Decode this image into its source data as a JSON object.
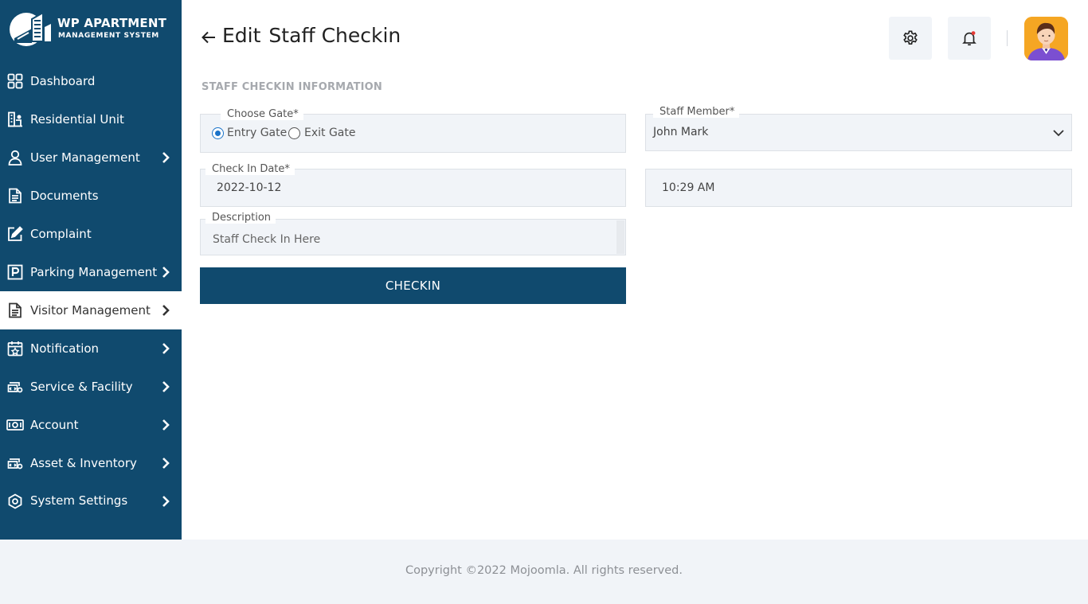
{
  "brand": {
    "line1": "WP APARTMENT",
    "line2": "MANAGEMENT SYSTEM"
  },
  "sidebar": {
    "items": [
      {
        "label": "Dashboard",
        "icon": "dashboard-grid-icon",
        "has_submenu": false,
        "active": false
      },
      {
        "label": "Residential Unit",
        "icon": "building-icon",
        "has_submenu": false,
        "active": false
      },
      {
        "label": "User Management",
        "icon": "user-icon",
        "has_submenu": true,
        "active": false
      },
      {
        "label": "Documents",
        "icon": "document-icon",
        "has_submenu": false,
        "active": false
      },
      {
        "label": "Complaint",
        "icon": "edit-icon",
        "has_submenu": false,
        "active": false
      },
      {
        "label": "Parking Management",
        "icon": "parking-icon",
        "has_submenu": true,
        "active": false
      },
      {
        "label": "Visitor Management",
        "icon": "visitor-document-icon",
        "has_submenu": true,
        "active": true
      },
      {
        "label": "Notification",
        "icon": "calendar-star-icon",
        "has_submenu": true,
        "active": false
      },
      {
        "label": "Service & Facility",
        "icon": "service-icon",
        "has_submenu": true,
        "active": false
      },
      {
        "label": "Account",
        "icon": "money-icon",
        "has_submenu": true,
        "active": false
      },
      {
        "label": "Asset & Inventory",
        "icon": "asset-icon",
        "has_submenu": true,
        "active": false
      },
      {
        "label": "System Settings",
        "icon": "settings-eye-icon",
        "has_submenu": true,
        "active": false
      }
    ]
  },
  "header": {
    "title_action": "Edit",
    "title_subject": "Staff Checkin",
    "settings_icon": "gear-icon",
    "notification_icon": "bell-icon"
  },
  "form": {
    "section_title": "STAFF CHECKIN INFORMATION",
    "gate": {
      "label": "Choose Gate*",
      "options": [
        "Entry Gate",
        "Exit Gate"
      ],
      "selected": "Entry Gate"
    },
    "staff_member": {
      "label": "Staff Member*",
      "value": "John Mark"
    },
    "check_in_date": {
      "label": "Check In Date*",
      "value": "2022-10-12"
    },
    "check_in_time": {
      "value": "10:29 AM"
    },
    "description": {
      "label": "Description",
      "placeholder": "Staff Check In Here"
    },
    "submit_label": "CHECKIN"
  },
  "footer": {
    "copyright": "Copyright ©2022 Mojoomla. All rights reserved."
  },
  "colors": {
    "primary": "#104a6e",
    "background_light": "#f1f4f8",
    "radio_accent": "#1a73c9",
    "notification_dot": "#e53935"
  }
}
